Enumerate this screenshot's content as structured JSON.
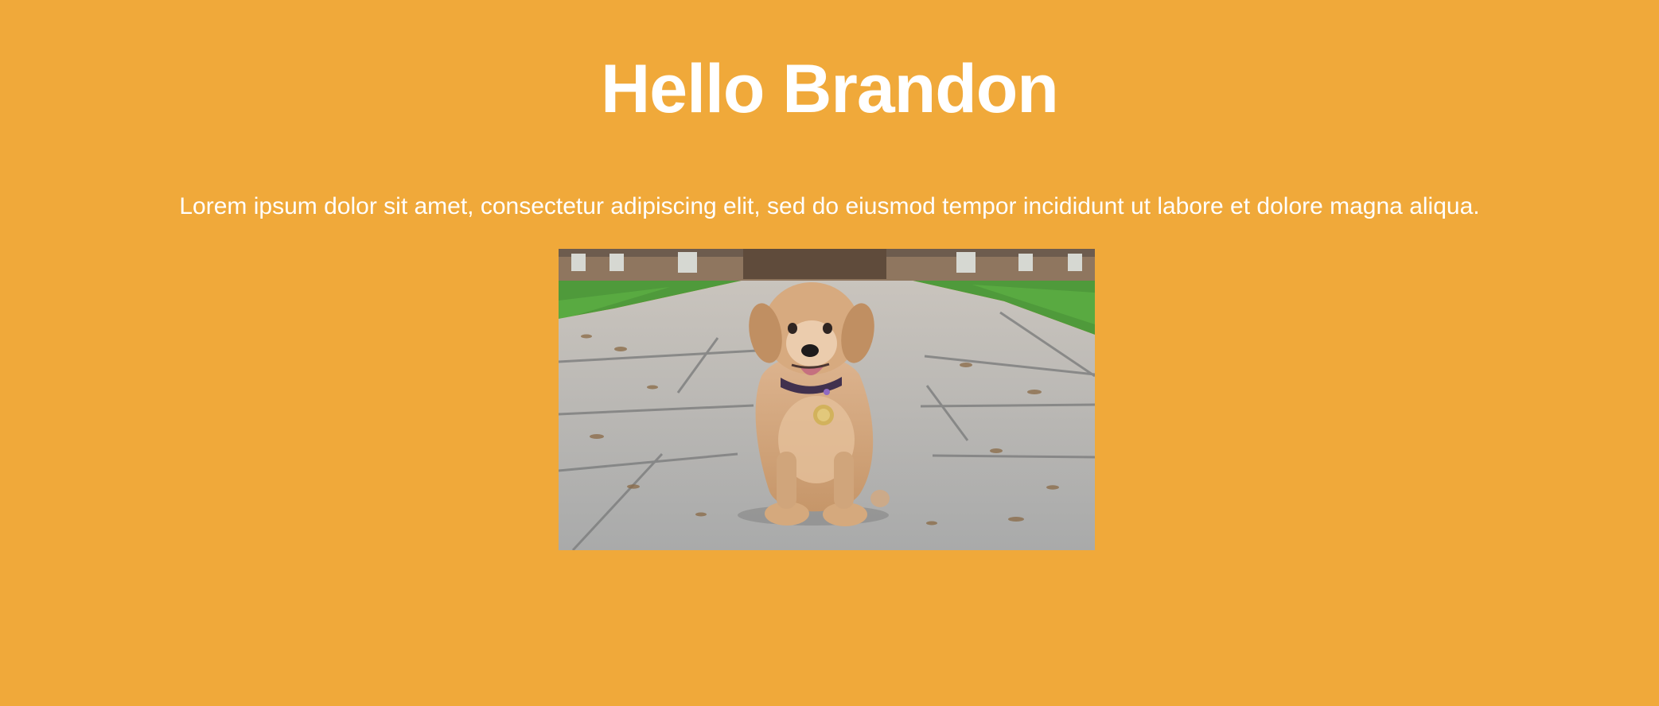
{
  "page": {
    "background_color": "#F0A93A",
    "text_color": "#FFFFFF"
  },
  "header": {
    "title": "Hello Brandon"
  },
  "main": {
    "paragraph": "Lorem ipsum dolor sit amet, consectetur adipiscing elit, sed do eiusmod tempor incididunt ut labore et dolore magna aliqua.",
    "image": {
      "subject": "golden-retriever-puppy-photo"
    }
  }
}
